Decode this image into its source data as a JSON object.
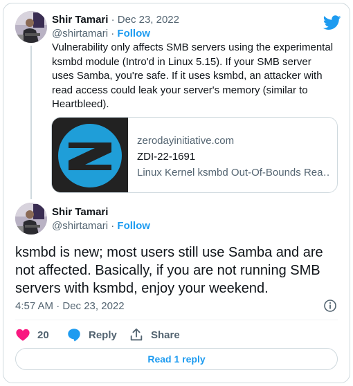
{
  "quoted_tweet": {
    "author_name": "Shir Tamari",
    "separator": "·",
    "date": "Dec 23, 2022",
    "handle": "@shirtamari",
    "follow_label": "Follow",
    "text": "Vulnerability only affects SMB servers using the experimental ksmbd module (Intro'd in Linux 5.15). If your SMB server uses Samba, you're safe. If it uses ksmbd, an attacker with read access could leak your server's memory (similar to Heartbleed).",
    "link_card": {
      "domain": "zerodayinitiative.com",
      "id": "ZDI-22-1691",
      "title": "Linux Kernel ksmbd Out-Of-Bounds Rea…"
    }
  },
  "main_tweet": {
    "author_name": "Shir Tamari",
    "handle": "@shirtamari",
    "separator": "·",
    "follow_label": "Follow",
    "text": "ksmbd is new; most users still use Samba and are not affected. Basically, if you are not running SMB servers with ksmbd, enjoy your weekend.",
    "timestamp": "4:57 AM · Dec 23, 2022",
    "likes": "20",
    "reply_label": "Reply",
    "share_label": "Share",
    "read_replies_label": "Read 1 reply"
  },
  "colors": {
    "accent": "#1d9bf0",
    "like": "#f91880",
    "muted": "#536471",
    "text": "#0f1419",
    "border": "#cfd9de"
  },
  "icons": [
    "twitter-bird-icon",
    "info-icon",
    "heart-icon",
    "reply-bubble-icon",
    "share-icon",
    "zdi-logo"
  ]
}
